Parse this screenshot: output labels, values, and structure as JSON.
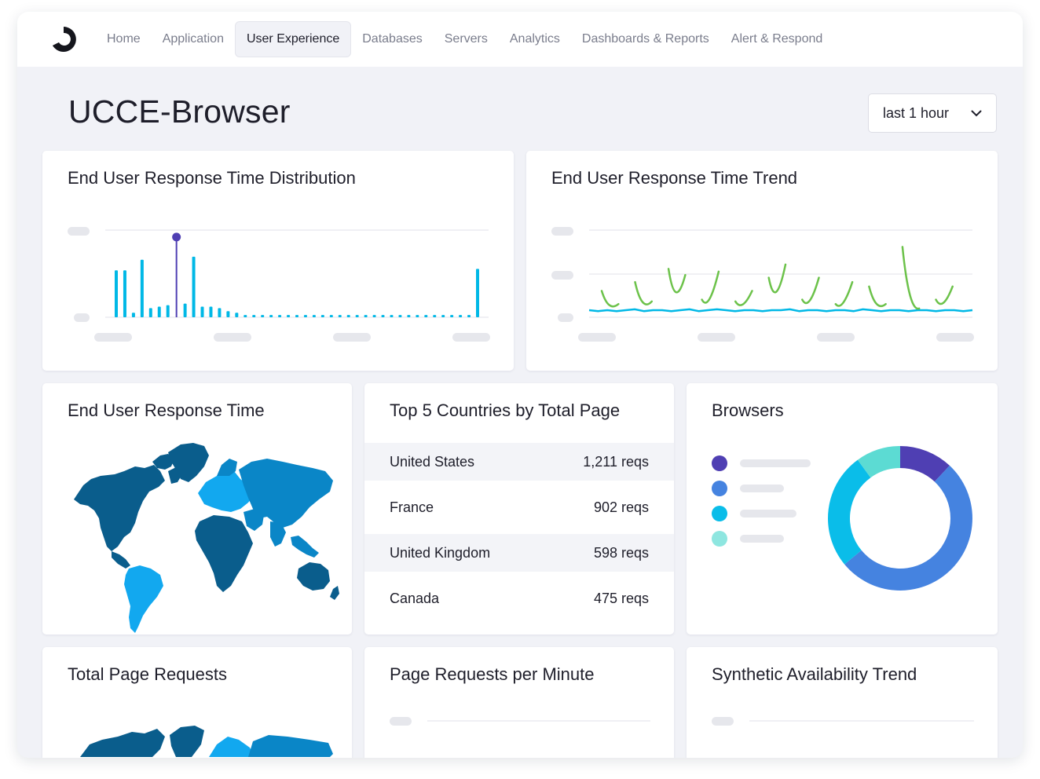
{
  "nav": {
    "items": [
      {
        "label": "Home",
        "active": false
      },
      {
        "label": "Application",
        "active": false
      },
      {
        "label": "User Experience",
        "active": true
      },
      {
        "label": "Databases",
        "active": false
      },
      {
        "label": "Servers",
        "active": false
      },
      {
        "label": "Analytics",
        "active": false
      },
      {
        "label": "Dashboards & Reports",
        "active": false
      },
      {
        "label": "Alert & Respond",
        "active": false
      }
    ]
  },
  "page": {
    "title": "UCCE-Browser",
    "time_range": "last 1 hour"
  },
  "cards": {
    "distribution": {
      "title": "End User Response Time Distribution"
    },
    "trend": {
      "title": "End User Response Time Trend"
    },
    "map": {
      "title": "End User Response Time"
    },
    "countries": {
      "title": "Top 5 Countries by Total Page",
      "rows": [
        {
          "country": "United States",
          "value": "1,211 reqs"
        },
        {
          "country": "France",
          "value": "902 reqs"
        },
        {
          "country": "United Kingdom",
          "value": "598 reqs"
        },
        {
          "country": "Canada",
          "value": "475 reqs"
        }
      ]
    },
    "browsers": {
      "title": "Browsers"
    },
    "total_requests": {
      "title": "Total Page Requests"
    },
    "per_minute": {
      "title": "Page Requests per Minute"
    },
    "synthetic": {
      "title": "Synthetic Availability Trend"
    }
  },
  "colors": {
    "accent": "#00b8e6",
    "highlight": "#4f3fb3",
    "trend_line": "#6cc24a",
    "map_dark": "#0a5d8c",
    "map_mid": "#0a86c7",
    "map_light": "#12a8ef"
  },
  "chart_data": [
    {
      "type": "bar",
      "title": "End User Response Time Distribution",
      "values": [
        62,
        62,
        6,
        76,
        12,
        14,
        16,
        106,
        18,
        80,
        14,
        14,
        12,
        8,
        6,
        3,
        3,
        3,
        3,
        3,
        3,
        3,
        3,
        3,
        3,
        3,
        3,
        3,
        3,
        3,
        3,
        3,
        3,
        3,
        3,
        3,
        3,
        3,
        3,
        3,
        3,
        3,
        64
      ],
      "highlight_index": 7,
      "grid": true
    },
    {
      "type": "line",
      "title": "End User Response Time Trend",
      "series": [
        {
          "values": [
            8,
            7,
            8,
            7,
            8,
            9,
            7,
            8,
            8,
            7,
            8,
            9,
            7,
            8,
            9,
            8,
            7,
            8,
            8,
            7,
            8,
            8,
            9,
            7,
            8,
            8,
            7,
            8,
            8,
            7,
            9,
            8,
            7,
            8,
            8,
            7,
            8,
            8,
            7,
            8,
            8,
            7,
            8
          ]
        },
        {
          "values": [
            30,
            15,
            40,
            18,
            55,
            48,
            20,
            52,
            18,
            30,
            45,
            60,
            20,
            45,
            15,
            40,
            35,
            15,
            80,
            10,
            20,
            35
          ]
        }
      ],
      "grid": true
    },
    {
      "type": "pie",
      "title": "Browsers",
      "values": [
        12,
        52,
        26,
        10
      ]
    }
  ]
}
